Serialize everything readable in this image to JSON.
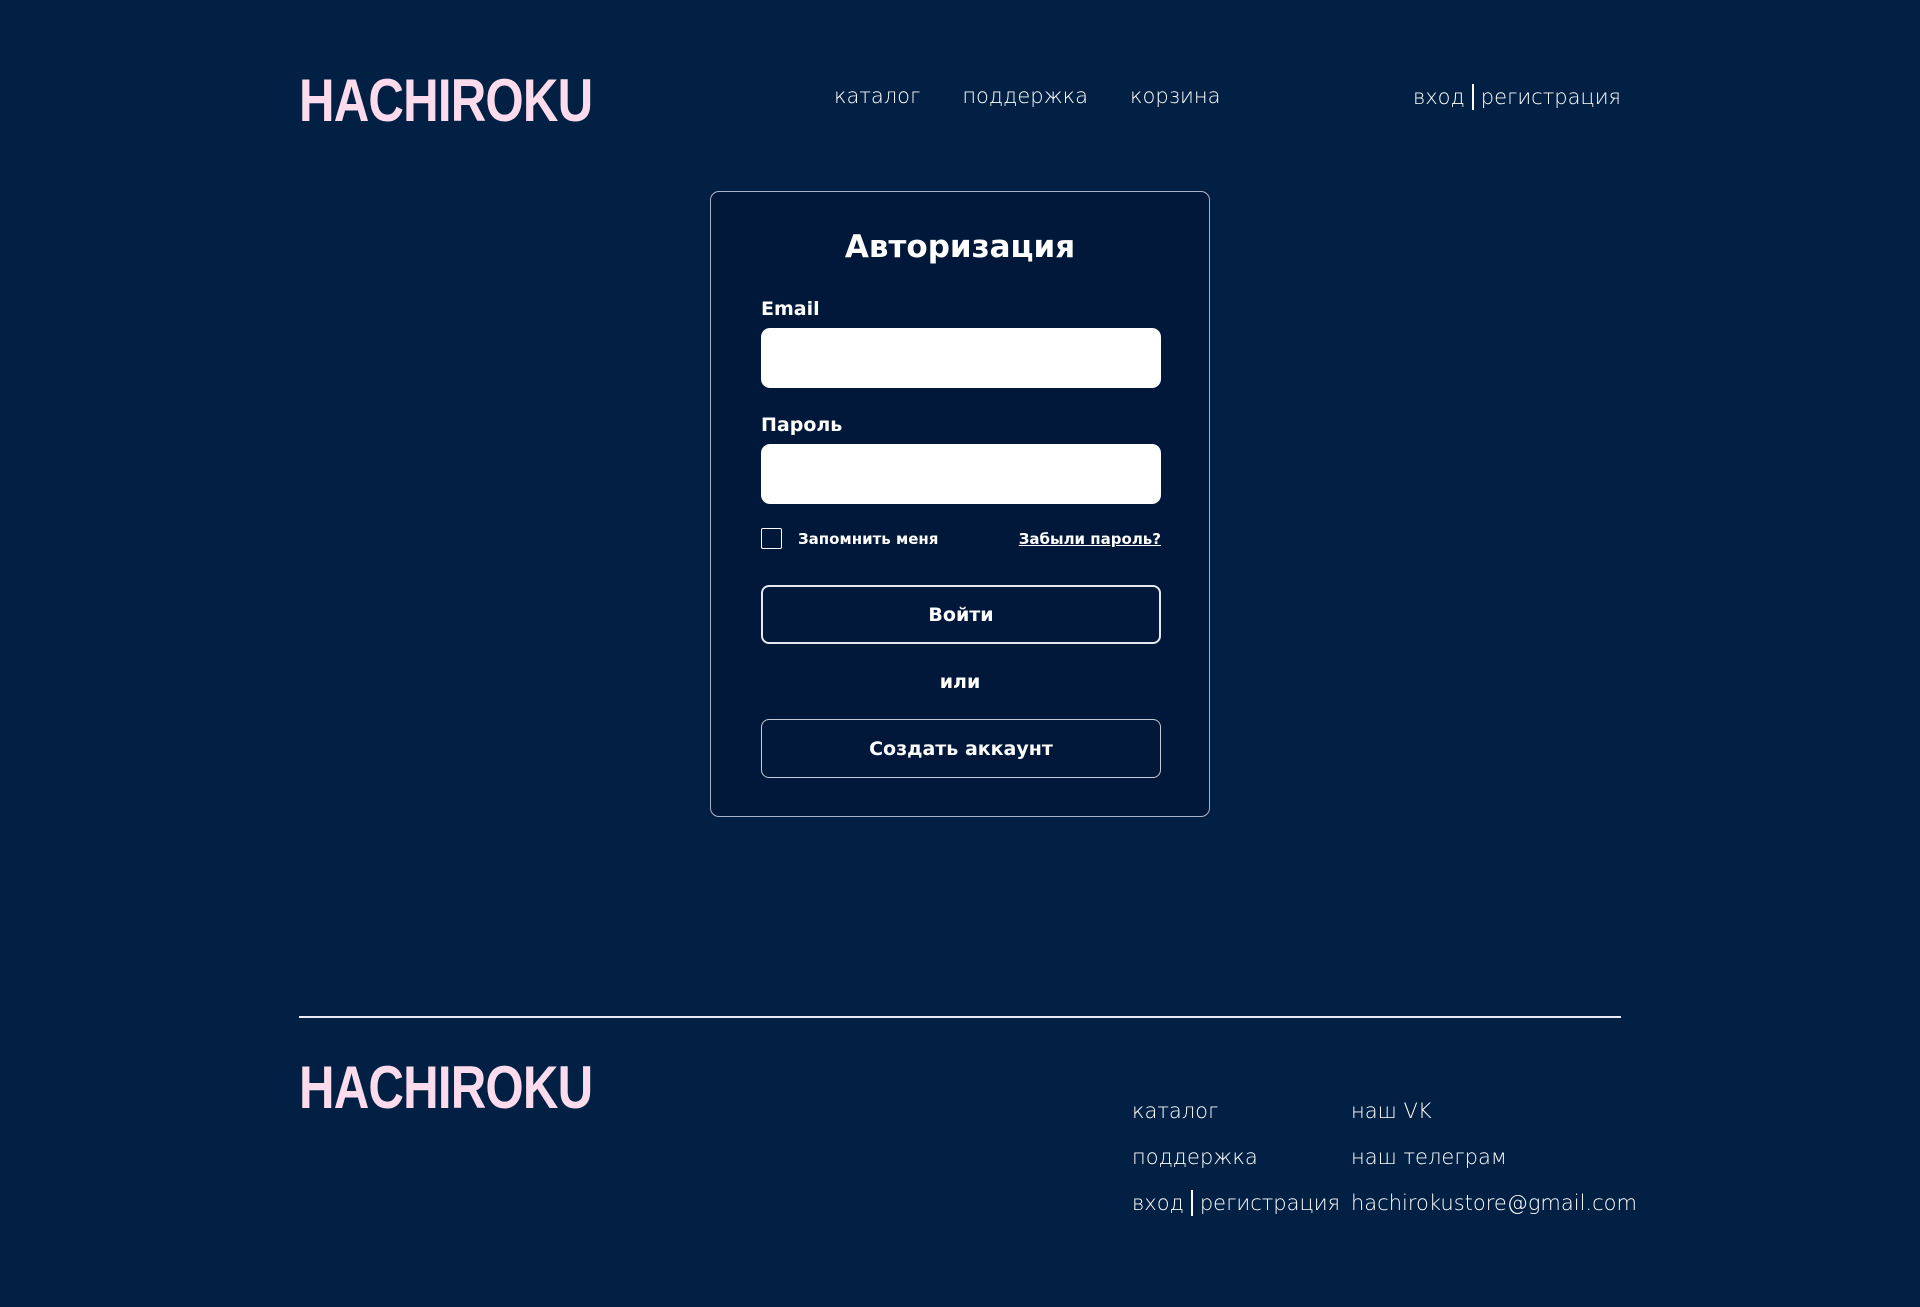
{
  "brand": {
    "logo_text": "HACHIROKU"
  },
  "header": {
    "nav": [
      {
        "label": "каталог"
      },
      {
        "label": "поддержка"
      },
      {
        "label": "корзина"
      }
    ],
    "login_label": "вход",
    "register_label": "регистрация"
  },
  "login_form": {
    "title": "Авторизация",
    "email_label": "Email",
    "email_value": "",
    "password_label": "Пароль",
    "password_value": "",
    "remember_label": "Запомнить меня",
    "remember_checked": false,
    "forgot_label": "Забыли пароль?",
    "submit_label": "Войти",
    "or_text": "или",
    "create_account_label": "Создать аккаунт"
  },
  "footer": {
    "logo_text": "HACHIROKU",
    "col1": {
      "catalog": "каталог",
      "support": "поддержка",
      "login": "вход",
      "register": "регистрация"
    },
    "col2": {
      "vk": "наш VK",
      "telegram": "наш телеграм",
      "email": "hachirokustore@gmail.com"
    }
  },
  "colors": {
    "background": "#022044",
    "card_background": "#01183a",
    "logo": "#fcdcec",
    "text": "#ffffff"
  }
}
